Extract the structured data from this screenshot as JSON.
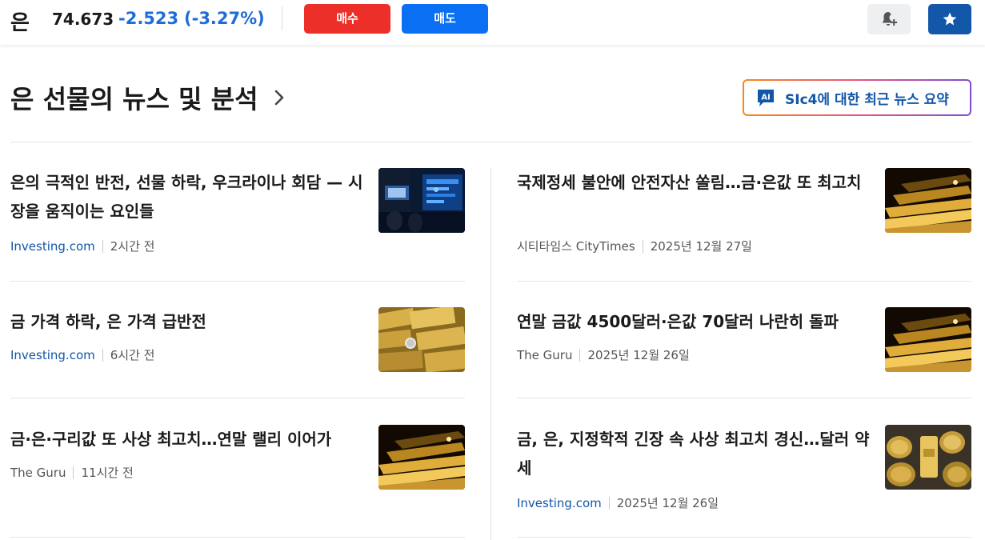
{
  "topbar": {
    "instrument_name": "은",
    "price": "74.673",
    "change": "-2.523",
    "change_pct": "(-3.27%)",
    "buy_label": "매수",
    "sell_label": "매도",
    "alert_icon": "bell-plus-icon",
    "watchlist_icon": "star-icon"
  },
  "section": {
    "title": "은 선물의 뉴스 및 분석",
    "ai_summary_label": "SIc4에 대한 최근 뉴스 요약",
    "ai_badge_text": "AI"
  },
  "colors": {
    "buy": "#ed2f2a",
    "sell": "#0a6ff2",
    "negative_change": "#1e6cd6",
    "link": "#1256a8"
  },
  "news": {
    "left": [
      {
        "headline": "은의 극적인 반전, 선물 하락, 우크라이나 회담 — 시장을 움직이는 요인들",
        "source": "Investing.com",
        "time": "2시간 전",
        "thumb": "trading-floor-screens"
      },
      {
        "headline": "금 가격 하락, 은 가격 급반전",
        "source": "Investing.com",
        "time": "6시간 전",
        "thumb": "gold-bars-coins"
      },
      {
        "headline": "금·은·구리값 또 사상 최고치…연말 랠리 이어가",
        "source": "The Guru",
        "time": "11시간 전",
        "thumb": "gold-bars-stack"
      }
    ],
    "right": [
      {
        "headline": "국제정세 불안에 안전자산 쏠림…금·은값 또 최고치",
        "source": "시티타임스 CityTimes",
        "time": "2025년 12월 27일",
        "thumb": "gold-bars-stack"
      },
      {
        "headline": "연말 금값 4500달러·은값 70달러 나란히 돌파",
        "source": "The Guru",
        "time": "2025년 12월 26일",
        "thumb": "gold-bars-stack"
      },
      {
        "headline": "금, 은, 지정학적 긴장 속 사상 최고치 경신…달러 약세",
        "source": "Investing.com",
        "time": "2025년 12월 26일",
        "thumb": "gold-coins-bar"
      }
    ]
  }
}
